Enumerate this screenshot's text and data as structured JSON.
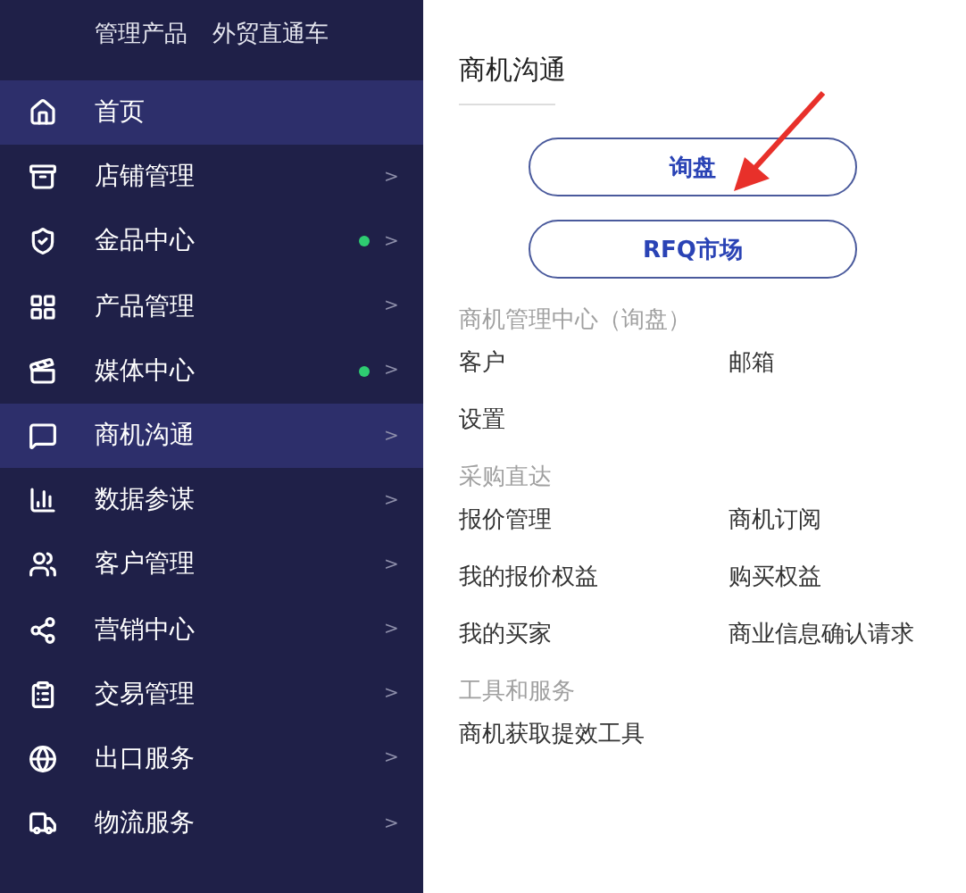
{
  "quick_links": [
    "管理产品",
    "外贸直通车"
  ],
  "sidebar": {
    "items": [
      {
        "label": "首页",
        "highlighted": true,
        "dot": false
      },
      {
        "label": "店铺管理",
        "highlighted": false,
        "dot": false,
        "chevron": ">"
      },
      {
        "label": "金品中心",
        "highlighted": false,
        "dot": true,
        "chevron": ">"
      },
      {
        "label": "产品管理",
        "highlighted": false,
        "dot": false,
        "chevron": ">"
      },
      {
        "label": "媒体中心",
        "highlighted": false,
        "dot": true,
        "chevron": ">"
      },
      {
        "label": "商机沟通",
        "highlighted": true,
        "dot": false,
        "chevron": ">"
      },
      {
        "label": "数据参谋",
        "highlighted": false,
        "dot": false,
        "chevron": ">"
      },
      {
        "label": "客户管理",
        "highlighted": false,
        "dot": false,
        "chevron": ">"
      },
      {
        "label": "营销中心",
        "highlighted": false,
        "dot": false,
        "chevron": ">"
      },
      {
        "label": "交易管理",
        "highlighted": false,
        "dot": false,
        "chevron": ">"
      },
      {
        "label": "出口服务",
        "highlighted": false,
        "dot": false,
        "chevron": ">"
      },
      {
        "label": "物流服务",
        "highlighted": false,
        "dot": false,
        "chevron": ">"
      }
    ]
  },
  "panel": {
    "title": "商机沟通",
    "buttons": [
      "询盘",
      "RFQ市场"
    ],
    "sections": [
      {
        "heading": "商机管理中心（询盘）",
        "links": [
          "客户",
          "邮箱",
          "设置"
        ]
      },
      {
        "heading": "采购直达",
        "links": [
          "报价管理",
          "商机订阅",
          "我的报价权益",
          "购买权益",
          "我的买家",
          "商业信息确认请求"
        ]
      },
      {
        "heading": "工具和服务",
        "links": [
          "商机获取提效工具"
        ]
      }
    ]
  }
}
